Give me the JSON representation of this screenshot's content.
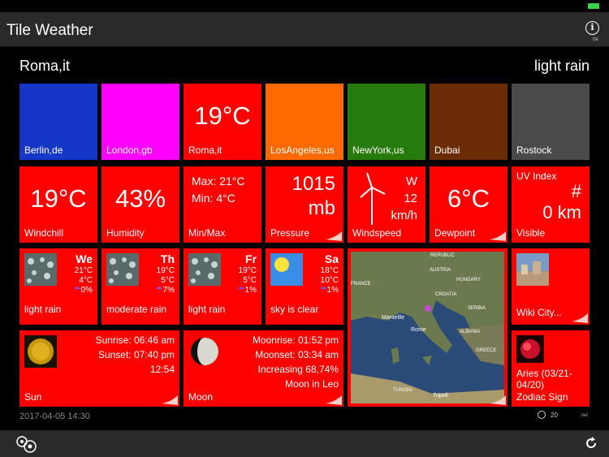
{
  "app": {
    "title": "Tile Weather",
    "info_sub": "DE"
  },
  "header": {
    "city": "Roma,it",
    "condition": "light rain"
  },
  "cities": [
    {
      "name": "Berlin,de",
      "color": "#1636c8"
    },
    {
      "name": "London,gb",
      "color": "#ff00ff"
    },
    {
      "name": "Roma,it",
      "color": "#ff0000",
      "temp": "19°C"
    },
    {
      "name": "LosAngeles,us",
      "color": "#ff6a00"
    },
    {
      "name": "NewYork,us",
      "color": "#277a0c"
    },
    {
      "name": "Dubai",
      "color": "#6b2c05"
    },
    {
      "name": "Rostock",
      "color": "#4a4a4a"
    }
  ],
  "metrics": {
    "windchill": {
      "value": "19°C",
      "label": "Windchill"
    },
    "humidity": {
      "value": "43%",
      "label": "Humidity"
    },
    "minmax": {
      "max": "Max: 21°C",
      "min": "Min: 4°C",
      "label": "Min/Max"
    },
    "pressure": {
      "value": "1015",
      "unit": "mb",
      "label": "Pressure"
    },
    "wind": {
      "dir": "W",
      "speed": "12",
      "unit": "km/h",
      "label": "Windspeed"
    },
    "dewpoint": {
      "value": "6°C",
      "label": "Dewpoint"
    },
    "uv": {
      "title": "UV Index",
      "value": "#",
      "visible": "0 km",
      "label": "Visible"
    }
  },
  "forecast": [
    {
      "day": "We",
      "hi": "21°C",
      "lo": "4°C",
      "rain": "0%",
      "cond": "light rain",
      "icon": "rain-icon"
    },
    {
      "day": "Th",
      "hi": "19°C",
      "lo": "5°C",
      "rain": "7%",
      "cond": "moderate rain",
      "icon": "rain-icon"
    },
    {
      "day": "Fr",
      "hi": "19°C",
      "lo": "5°C",
      "rain": "1%",
      "cond": "light rain",
      "icon": "rain-icon"
    },
    {
      "day": "Sa",
      "hi": "18°C",
      "lo": "10°C",
      "rain": "1%",
      "cond": "sky is clear",
      "icon": "sun-icon"
    }
  ],
  "map": {
    "labels": [
      "REPUBLIC",
      "AUSTRIA",
      "HUNGARY",
      "FRANCE",
      "CROATIA",
      "SERBIA",
      "Marseille",
      "Rome",
      "ALBANIA",
      "GREECE",
      "TUNISIA",
      "Tripoli"
    ]
  },
  "wiki": {
    "label": "Wiki City..."
  },
  "sun": {
    "sunrise": "Sunrise: 06:46 am",
    "sunset": "Sunset: 07:40 pm",
    "daylength": "12:54",
    "label": "Sun"
  },
  "moon": {
    "moonrise": "Moonrise: 01:52 pm",
    "moonset": "Moonset: 03:34 am",
    "phase": "Increasing  68,74%",
    "sign": "Moon in Leo",
    "label": "Moon"
  },
  "zodiac": {
    "name": "Aries (03/21-04/20)",
    "label": "Zodiac Sign"
  },
  "footer": {
    "datetime": "2017-04-05 14:30",
    "count": "20",
    "net": ".net"
  }
}
